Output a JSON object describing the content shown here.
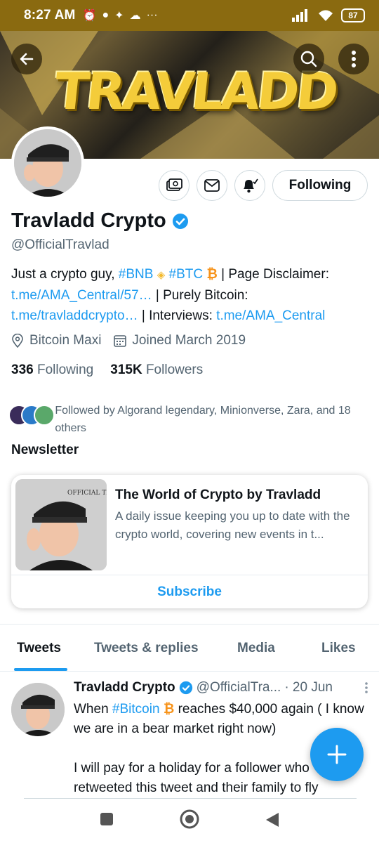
{
  "status_bar": {
    "time": "8:27 AM",
    "battery": "87"
  },
  "banner": {
    "text": "TRAVLADD"
  },
  "profile": {
    "display_name": "Travladd Crypto",
    "handle": "@OfficialTravlad",
    "follow_button": "Following",
    "bio": {
      "part1": "Just a crypto guy, ",
      "tag_bnb": "#BNB",
      "tag_btc": "#BTC",
      "part2": " | Page Disclaimer: ",
      "link1": "t.me/AMA_Central/57…",
      "part3": " | Purely Bitcoin: ",
      "link2": "t.me/travladdcrypto…",
      "part4": " | Interviews: ",
      "link3": "t.me/AMA_Central"
    },
    "location": "Bitcoin Maxi",
    "joined": "Joined March 2019",
    "following_count": "336",
    "following_label": "Following",
    "followers_count": "315K",
    "followers_label": "Followers",
    "followed_by": "Followed by Algorand legendary, Minionverse, Zara, and 18 others"
  },
  "newsletter": {
    "section_title": "Newsletter",
    "title": "The World of Crypto by Travladd",
    "description": "A daily issue keeping you up to date with the crypto world, covering new events in t...",
    "subscribe": "Subscribe",
    "image_text": "OFFICIAL TRAVLADD"
  },
  "tabs": [
    {
      "label": "Tweets",
      "active": true
    },
    {
      "label": "Tweets & replies",
      "active": false
    },
    {
      "label": "Media",
      "active": false
    },
    {
      "label": "Likes",
      "active": false
    }
  ],
  "tweet": {
    "name": "Travladd Crypto",
    "handle": "@OfficialTra...",
    "time": "· 20 Jun",
    "line1_a": "When ",
    "hashtag": "#Bitcoin",
    "line1_b": " reaches $40,000 again ( I know we are in a bear market right now)",
    "line2": "I will pay for a holiday for a follower who retweeted this tweet and their family to fly"
  },
  "colors": {
    "accent": "#1d9bf0",
    "status_bar": "#8a6a10",
    "bnb": "#f3ba2f",
    "btc": "#f7931a"
  }
}
